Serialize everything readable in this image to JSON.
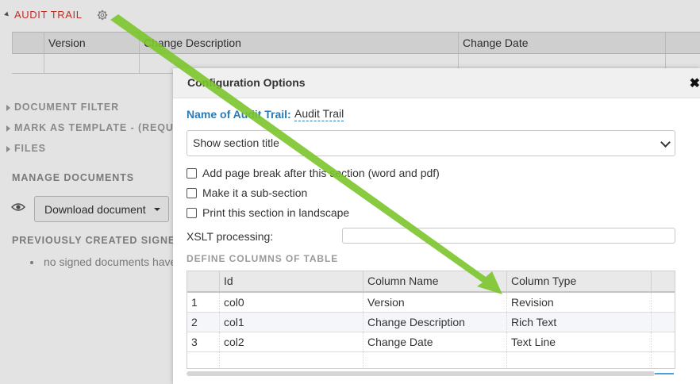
{
  "background": {
    "section_title": "AUDIT TRAIL",
    "grid_headers": [
      "Version",
      "Change Description",
      "Change Date"
    ],
    "side_sections": [
      "DOCUMENT FILTER",
      "MARK AS TEMPLATE - (REQU",
      "FILES"
    ],
    "manage_documents": "MANAGE DOCUMENTS",
    "download_button": "Download document",
    "previously_created": "PREVIOUSLY CREATED SIGNE",
    "no_signed": "no signed documents have"
  },
  "dialog": {
    "title": "Configuration Options",
    "close": "✖",
    "name_label": "Name of Audit Trail:",
    "name_value": "Audit Trail",
    "select_value": "Show section title",
    "checkboxes": [
      {
        "label": "Add page break after this section (word and pdf)",
        "checked": false
      },
      {
        "label": "Make it a sub-section",
        "checked": false
      },
      {
        "label": "Print this section in landscape",
        "checked": false
      }
    ],
    "xslt_label": "XSLT processing:",
    "xslt_value": "",
    "define_columns": "DEFINE COLUMNS OF TABLE",
    "table": {
      "headers": [
        "",
        "Id",
        "Column Name",
        "Column Type"
      ],
      "rows": [
        {
          "num": "1",
          "id": "col0",
          "name": "Version",
          "type": "Revision"
        },
        {
          "num": "2",
          "id": "col1",
          "name": "Change Description",
          "type": "Rich Text"
        },
        {
          "num": "3",
          "id": "col2",
          "name": "Change Date",
          "type": "Text Line"
        }
      ]
    }
  },
  "colors": {
    "section_title": "#d9342b",
    "link_blue": "#2a7ab8",
    "arrow": "#7cc52b"
  }
}
